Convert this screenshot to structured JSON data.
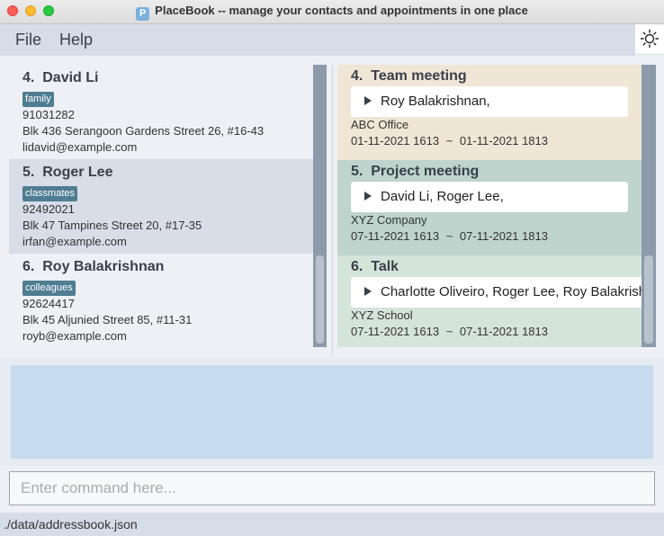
{
  "window": {
    "title": "PlaceBook -- manage your contacts and appointments in one place",
    "app_icon": "P"
  },
  "menu": {
    "file": "File",
    "help": "Help"
  },
  "theme_icon": "sun-icon",
  "persons": [
    {
      "index": "4.",
      "name": "David Li",
      "tag": "family",
      "phone": "91031282",
      "address": "Blk 436 Serangoon Gardens Street 26, #16-43",
      "email": "lidavid@example.com"
    },
    {
      "index": "5.",
      "name": "Roger Lee",
      "tag": "classmates",
      "phone": "92492021",
      "address": "Blk 47 Tampines Street 20, #17-35",
      "email": "irfan@example.com"
    },
    {
      "index": "6.",
      "name": "Roy Balakrishnan",
      "tag": "colleagues",
      "phone": "92624417",
      "address": "Blk 45 Aljunied Street 85, #11-31",
      "email": "royb@example.com"
    }
  ],
  "appointments": [
    {
      "index": "4.",
      "title": "Team meeting",
      "clients": "Roy Balakrishnan,",
      "location": "ABC Office",
      "start": "01-11-2021 1613",
      "tilde": "~",
      "end": "01-11-2021 1813",
      "color": "#efe6d6"
    },
    {
      "index": "5.",
      "title": "Project meeting",
      "clients": "David Li, Roger Lee,",
      "location": "XYZ Company",
      "start": "07-11-2021 1613",
      "tilde": "~",
      "end": "07-11-2021 1813",
      "color": "#bed4cd"
    },
    {
      "index": "6.",
      "title": "Talk",
      "clients": "Charlotte Oliveiro, Roger Lee, Roy Balakrishnan,",
      "location": "XYZ School",
      "start": "07-11-2021 1613",
      "tilde": "~",
      "end": "07-11-2021 1813",
      "color": "#d5e4d9"
    }
  ],
  "command": {
    "placeholder": "Enter command here...",
    "value": ""
  },
  "status": {
    "path": "./data/addressbook.json"
  }
}
